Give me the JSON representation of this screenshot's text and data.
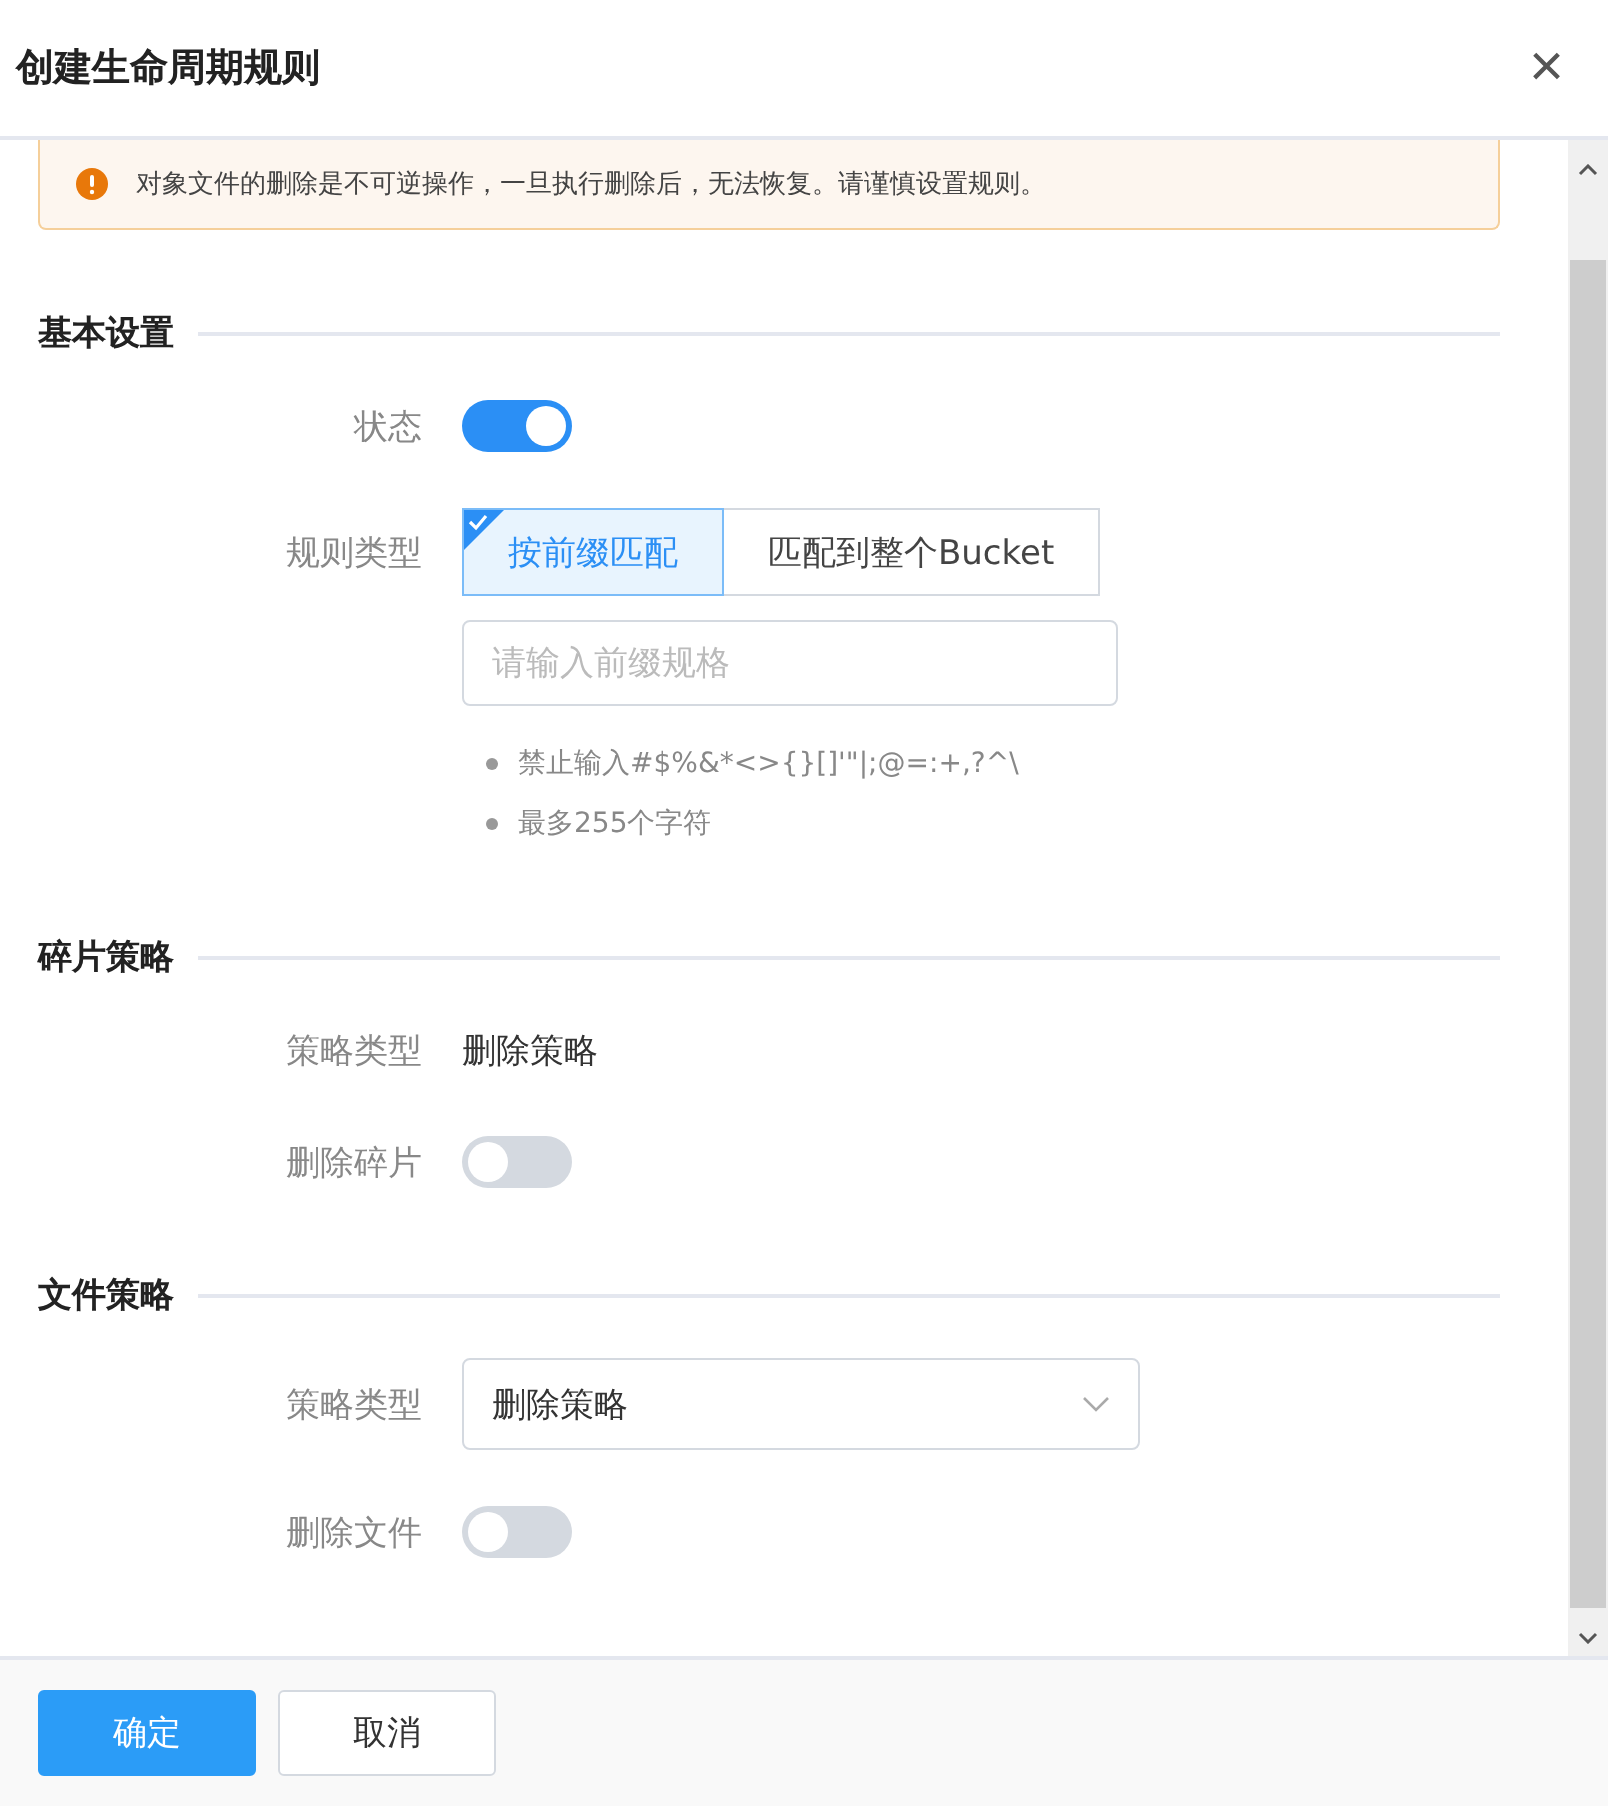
{
  "dialog": {
    "title": "创建生命周期规则",
    "close": "×"
  },
  "warning": {
    "text": "对象文件的删除是不可逆操作，一旦执行删除后，无法恢复。请谨慎设置规则。"
  },
  "sections": [
    {
      "title": "基本设置",
      "fields": [
        {
          "kind": "toggle",
          "label": "状态",
          "on": true
        },
        {
          "kind": "segmented",
          "label": "规则类型",
          "options": [
            {
              "label": "按前缀匹配",
              "selected": true
            },
            {
              "label": "匹配到整个Bucket",
              "selected": false
            }
          ]
        },
        {
          "kind": "input",
          "placeholder": "请输入前缀规格",
          "hints": [
            "禁止输入#$%&*<>{}[]'\"|;@=:+,?^\\",
            "最多255个字符"
          ]
        }
      ]
    },
    {
      "title": "碎片策略",
      "fields": [
        {
          "kind": "text",
          "label": "策略类型",
          "value": "删除策略"
        },
        {
          "kind": "toggle",
          "label": "删除碎片",
          "on": false
        }
      ]
    },
    {
      "title": "文件策略",
      "fields": [
        {
          "kind": "select",
          "label": "策略类型",
          "value": "删除策略"
        },
        {
          "kind": "toggle",
          "label": "删除文件",
          "on": false
        }
      ]
    }
  ],
  "buttons": [
    {
      "label": "确定",
      "kind": "primary"
    },
    {
      "label": "取消",
      "kind": "default"
    }
  ]
}
